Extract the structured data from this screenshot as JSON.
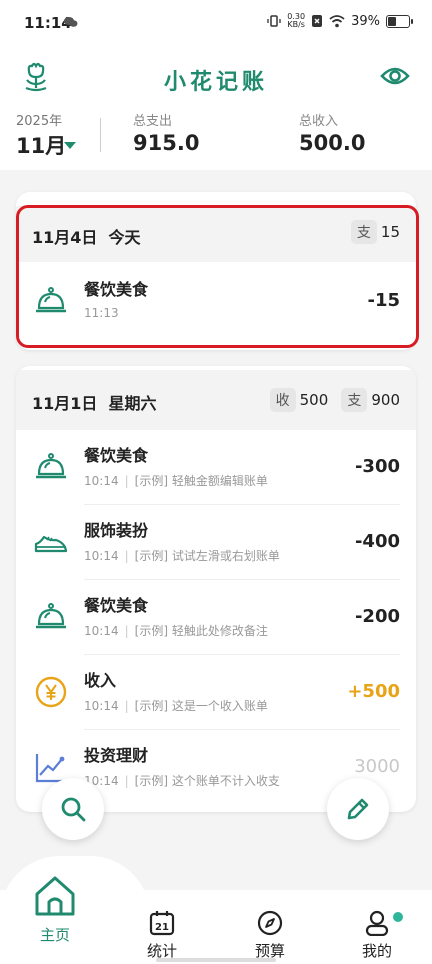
{
  "status": {
    "time": "11:14",
    "speed_top": "0.30",
    "speed_unit": "KB/s",
    "battery": "39%"
  },
  "app": {
    "title": "小花记账"
  },
  "summary": {
    "year": "2025年",
    "month": "11月",
    "expense_label": "总支出",
    "expense_value": "915.0",
    "income_label": "总收入",
    "income_value": "500.0"
  },
  "days": [
    {
      "date": "11月4日",
      "weekday": "今天",
      "expense_tag": "支",
      "expense_value": "15",
      "entries": [
        {
          "name": "餐饮美食",
          "time": "11:13",
          "note": "",
          "amount": "-15",
          "icon": "food-cloche-icon"
        }
      ]
    },
    {
      "date": "11月1日",
      "weekday": "星期六",
      "income_tag": "收",
      "income_value": "500",
      "expense_tag": "支",
      "expense_value": "900",
      "entries": [
        {
          "name": "餐饮美食",
          "time": "10:14",
          "note": "[示例] 轻触金额编辑账单",
          "amount": "-300",
          "icon": "food-cloche-icon"
        },
        {
          "name": "服饰装扮",
          "time": "10:14",
          "note": "[示例] 试试左滑或右划账单",
          "amount": "-400",
          "icon": "shoe-icon"
        },
        {
          "name": "餐饮美食",
          "time": "10:14",
          "note": "[示例] 轻触此处修改备注",
          "amount": "-200",
          "icon": "food-cloche-icon"
        },
        {
          "name": "收入",
          "time": "10:14",
          "note": "[示例] 这是一个收入账单",
          "amount": "+500",
          "icon": "yen-coin-icon"
        },
        {
          "name": "投资理财",
          "time": "10:14",
          "note": "[示例] 这个账单不计入收支",
          "amount": "3000",
          "icon": "investment-chart-icon"
        }
      ]
    }
  ],
  "tabs": [
    {
      "label": "主页",
      "icon": "home-icon",
      "active": true
    },
    {
      "label": "统计",
      "icon": "calendar-21-icon",
      "calendar_number": "21"
    },
    {
      "label": "预算",
      "icon": "compass-icon"
    },
    {
      "label": "我的",
      "icon": "user-icon"
    }
  ],
  "colors": {
    "accent": "#1f8a6e",
    "income": "#e8a317",
    "highlight_border": "#d81c24",
    "notification_dot": "#2fb59a"
  }
}
